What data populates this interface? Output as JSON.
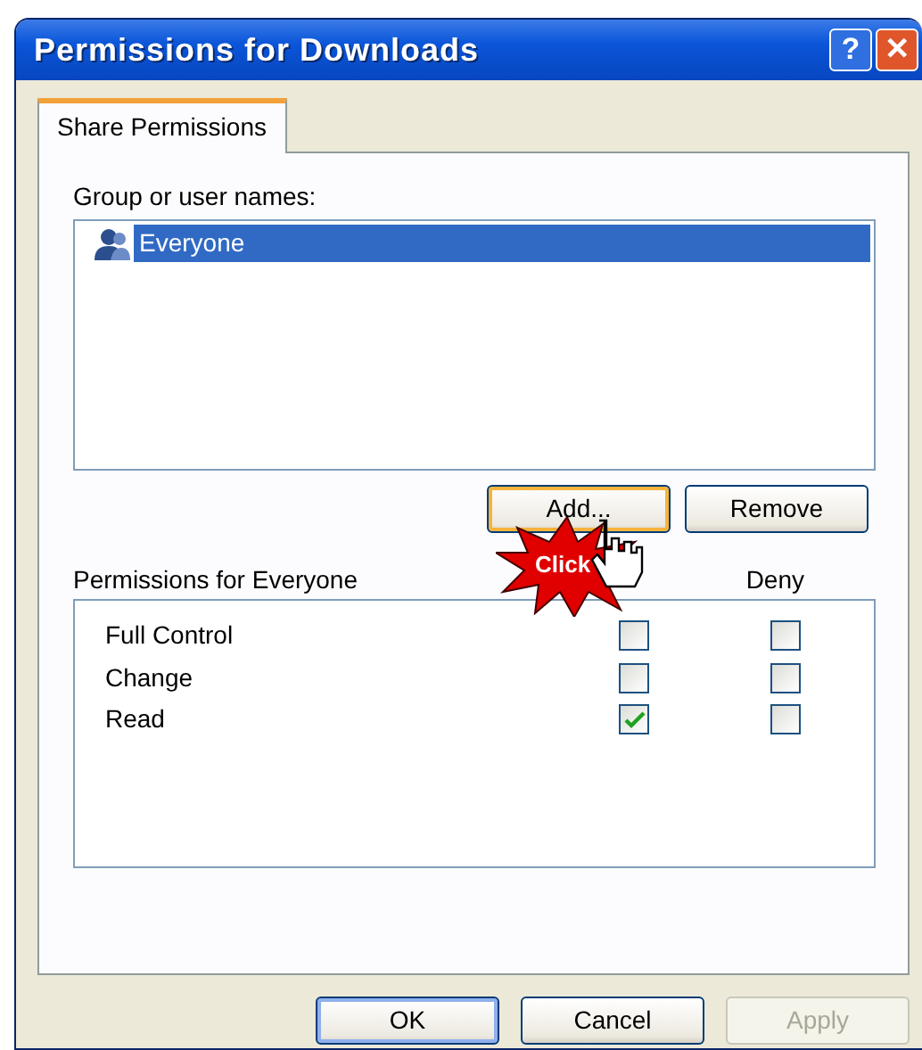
{
  "window": {
    "title": "Permissions for Downloads",
    "title_buttons": [
      "?",
      "✕"
    ]
  },
  "tabs": [
    {
      "label": "Share Permissions",
      "selected": true
    }
  ],
  "group_label": "Group or user names:",
  "users": [
    {
      "name": "Everyone",
      "selected": true
    }
  ],
  "user_buttons": [
    "Add...",
    "Remove"
  ],
  "permissions_label": "Permissions for Everyone",
  "deny_header": "Deny",
  "permissions": [
    {
      "name": "Full Control",
      "allow": false,
      "deny": false
    },
    {
      "name": "Change",
      "allow": false,
      "deny": false
    },
    {
      "name": "Read",
      "allow": true,
      "deny": false
    }
  ],
  "callout": {
    "text": "Click"
  },
  "buttons": [
    {
      "label": "OK",
      "disabled": false
    },
    {
      "label": "Cancel",
      "disabled": false
    },
    {
      "label": "Apply",
      "disabled": true
    }
  ]
}
